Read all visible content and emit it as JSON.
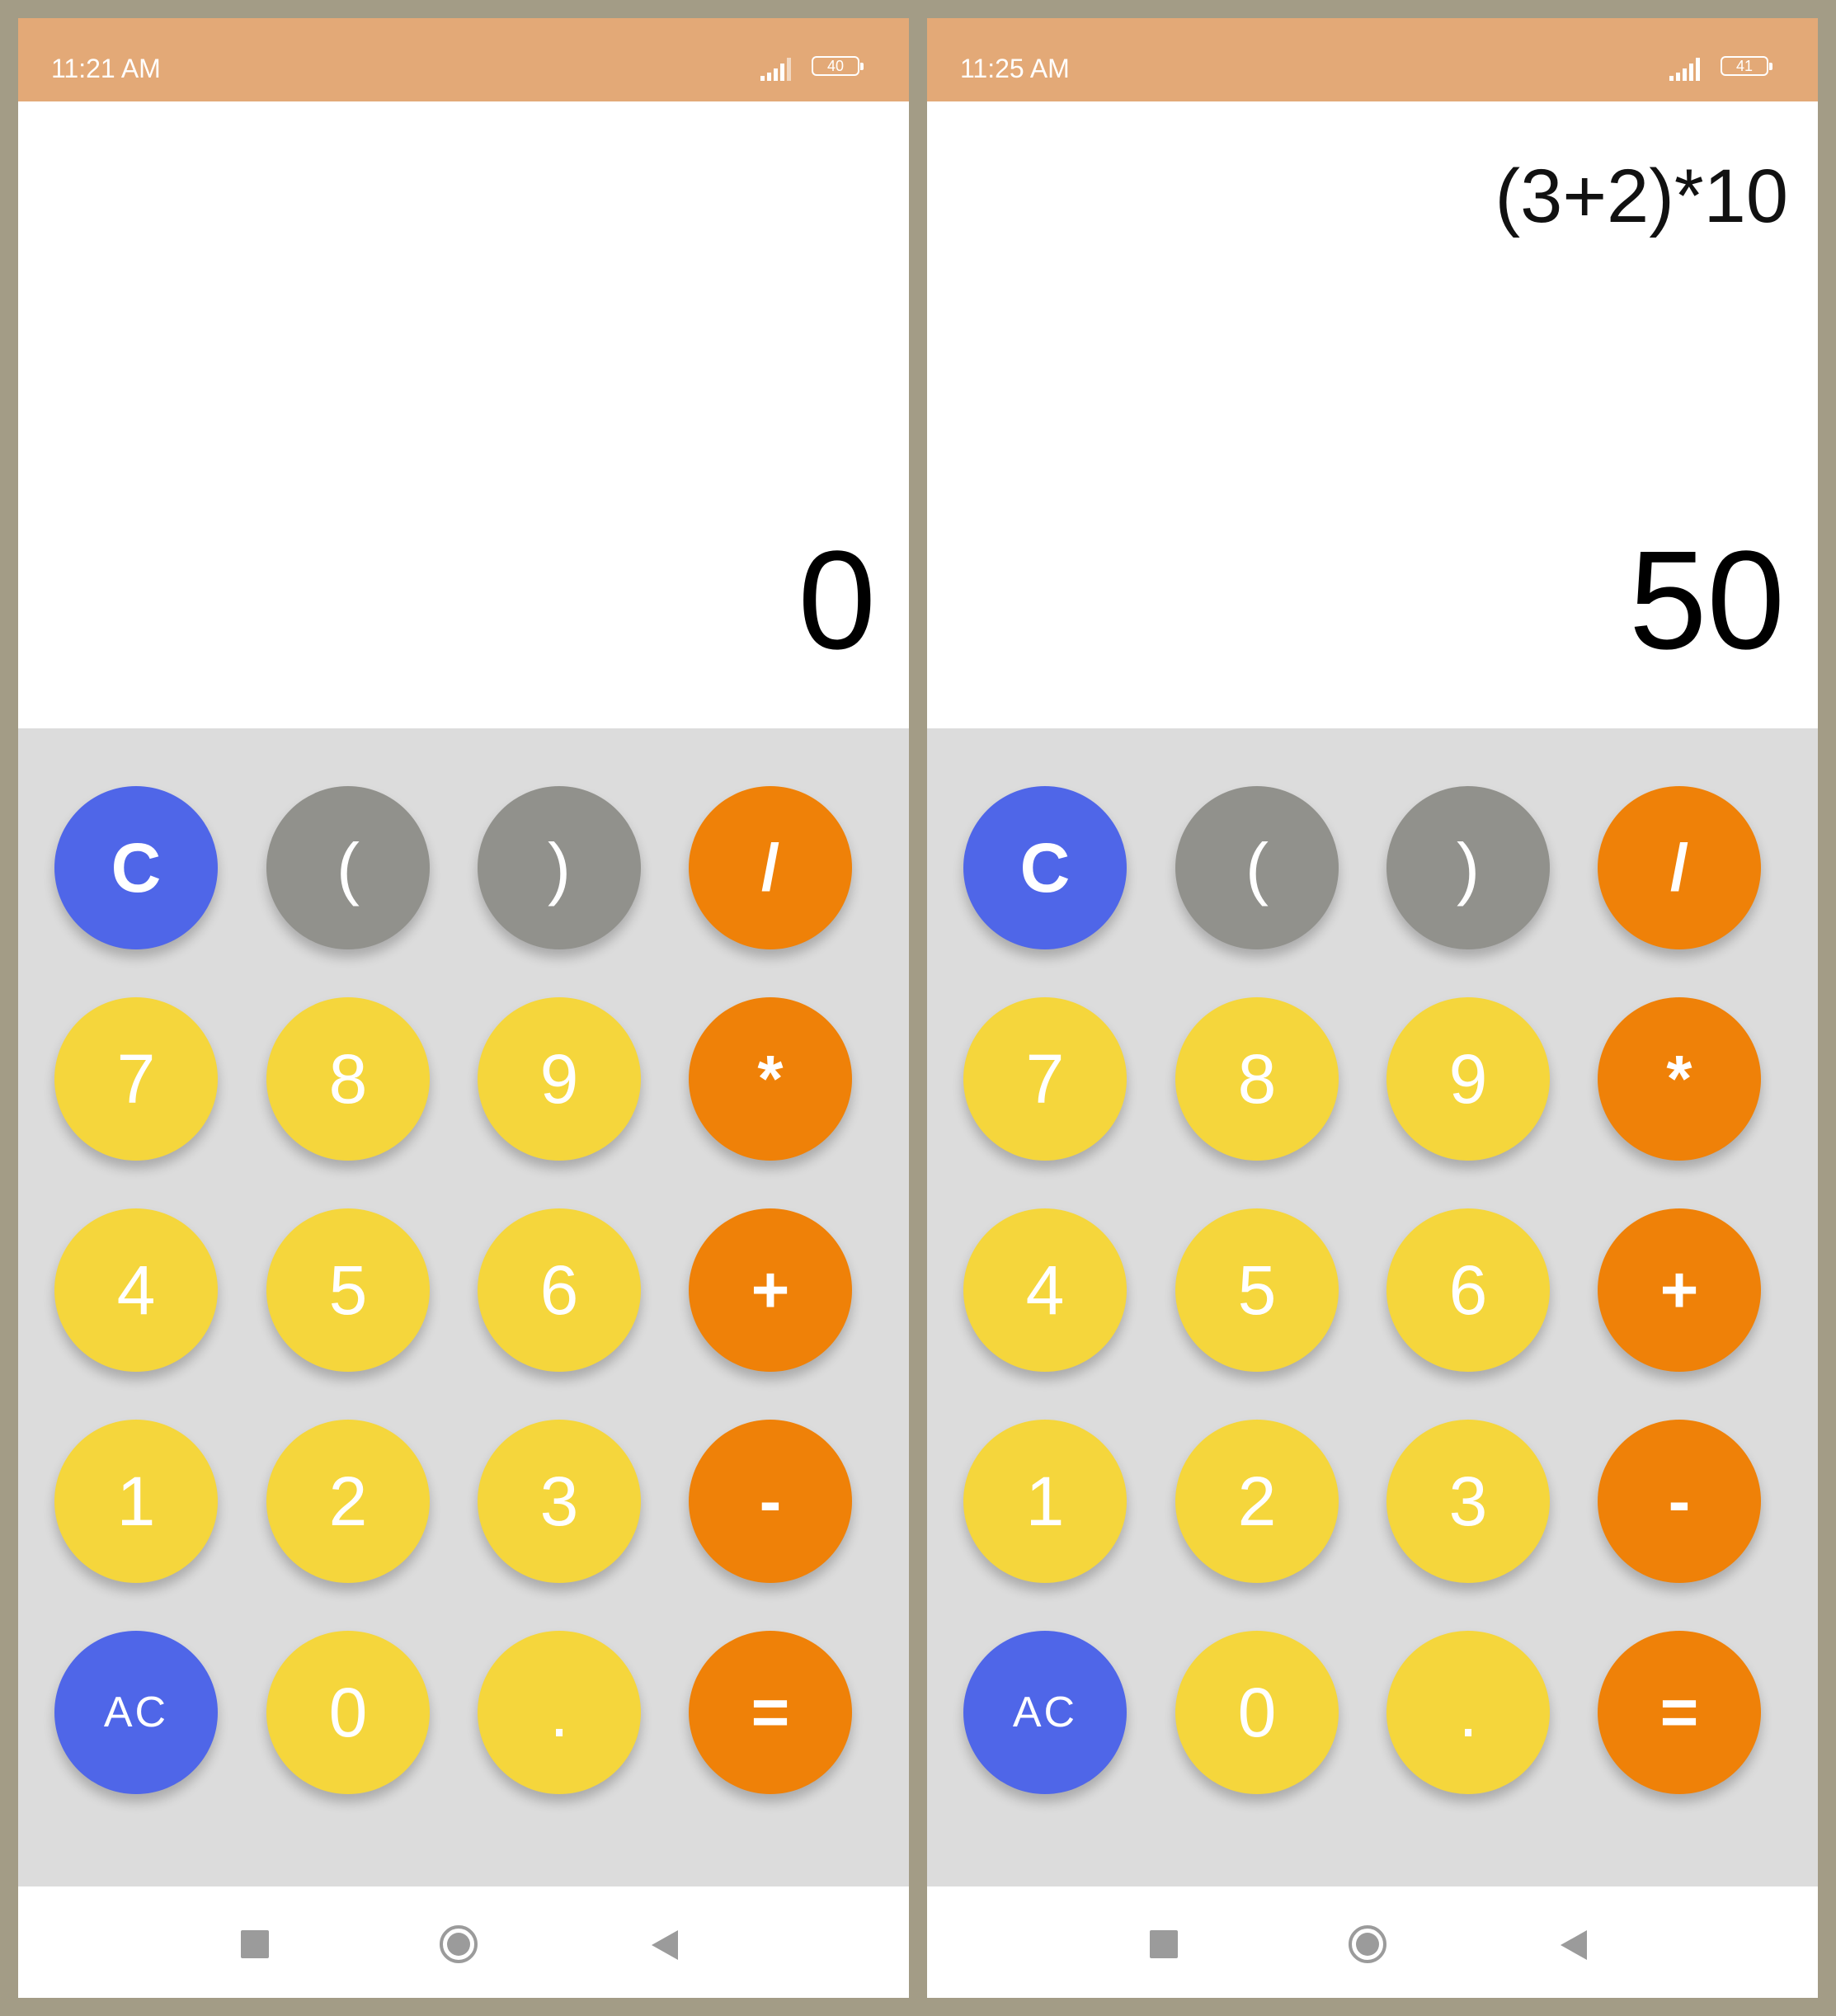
{
  "colors": {
    "frame": "#a39c86",
    "status_bar": "#e3a977",
    "keypad_bg": "#dcdcdc",
    "blue": "#4f66e8",
    "gray": "#91918c",
    "orange": "#ef8108",
    "yellow": "#f5d63c"
  },
  "screens": [
    {
      "status": {
        "time": "11:21 AM",
        "battery": "40"
      },
      "display": {
        "expression": "",
        "result": "0"
      }
    },
    {
      "status": {
        "time": "11:25 AM",
        "battery": "41"
      },
      "display": {
        "expression": "(3+2)*10",
        "result": "50"
      }
    }
  ],
  "keypad": {
    "rows": [
      [
        {
          "label": "C",
          "color": "blue",
          "name": "clear"
        },
        {
          "label": "(",
          "color": "gray",
          "name": "open-paren"
        },
        {
          "label": ")",
          "color": "gray",
          "name": "close-paren"
        },
        {
          "label": "/",
          "color": "orange",
          "name": "divide"
        }
      ],
      [
        {
          "label": "7",
          "color": "yellow",
          "name": "digit-7"
        },
        {
          "label": "8",
          "color": "yellow",
          "name": "digit-8"
        },
        {
          "label": "9",
          "color": "yellow",
          "name": "digit-9"
        },
        {
          "label": "*",
          "color": "orange",
          "name": "multiply"
        }
      ],
      [
        {
          "label": "4",
          "color": "yellow",
          "name": "digit-4"
        },
        {
          "label": "5",
          "color": "yellow",
          "name": "digit-5"
        },
        {
          "label": "6",
          "color": "yellow",
          "name": "digit-6"
        },
        {
          "label": "+",
          "color": "orange",
          "name": "add"
        }
      ],
      [
        {
          "label": "1",
          "color": "yellow",
          "name": "digit-1"
        },
        {
          "label": "2",
          "color": "yellow",
          "name": "digit-2"
        },
        {
          "label": "3",
          "color": "yellow",
          "name": "digit-3"
        },
        {
          "label": "-",
          "color": "orange",
          "name": "subtract"
        }
      ],
      [
        {
          "label": "AC",
          "color": "blue",
          "name": "all-clear"
        },
        {
          "label": "0",
          "color": "yellow",
          "name": "digit-0"
        },
        {
          "label": ".",
          "color": "yellow",
          "name": "decimal"
        },
        {
          "label": "=",
          "color": "orange",
          "name": "equals"
        }
      ]
    ]
  },
  "nav": {
    "icons": [
      "recents-square-icon",
      "home-circle-icon",
      "back-triangle-icon"
    ]
  }
}
